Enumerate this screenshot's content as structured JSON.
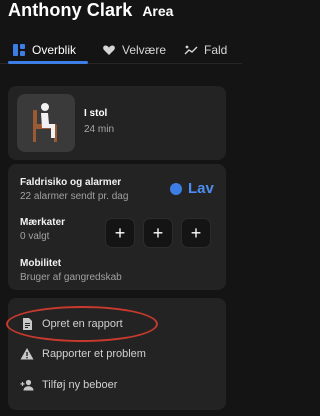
{
  "header": {
    "resident_name": "Anthony Clark",
    "area": "Area"
  },
  "tabs": [
    {
      "label": "Overblik",
      "icon": "grid-icon",
      "active": true
    },
    {
      "label": "Velvære",
      "icon": "heart-icon",
      "active": false
    },
    {
      "label": "Fald",
      "icon": "fall-icon",
      "active": false
    }
  ],
  "activity": {
    "icon": "person-sitting-in-chair-icon",
    "title": "I stol",
    "duration": "24 min"
  },
  "fall_risk": {
    "title": "Faldrisiko og alarmer",
    "subtitle": "22 alarmer sendt pr. dag",
    "level": "Lav",
    "level_color": "#3d7ee6"
  },
  "tags": {
    "title": "Mærkater",
    "subtitle": "0 valgt",
    "add_buttons": [
      "+",
      "+",
      "+"
    ]
  },
  "mobility": {
    "title": "Mobilitet",
    "subtitle": "Bruger af gangredskab"
  },
  "actions": [
    {
      "label": "Opret en rapport",
      "icon": "document-icon"
    },
    {
      "label": "Rapporter et problem",
      "icon": "warning-icon"
    },
    {
      "label": "Tilføj ny beboer",
      "icon": "add-user-icon"
    }
  ],
  "colors": {
    "accent": "#3d7ee6",
    "highlight": "#c8392e",
    "background": "#141414",
    "card": "#232323"
  }
}
